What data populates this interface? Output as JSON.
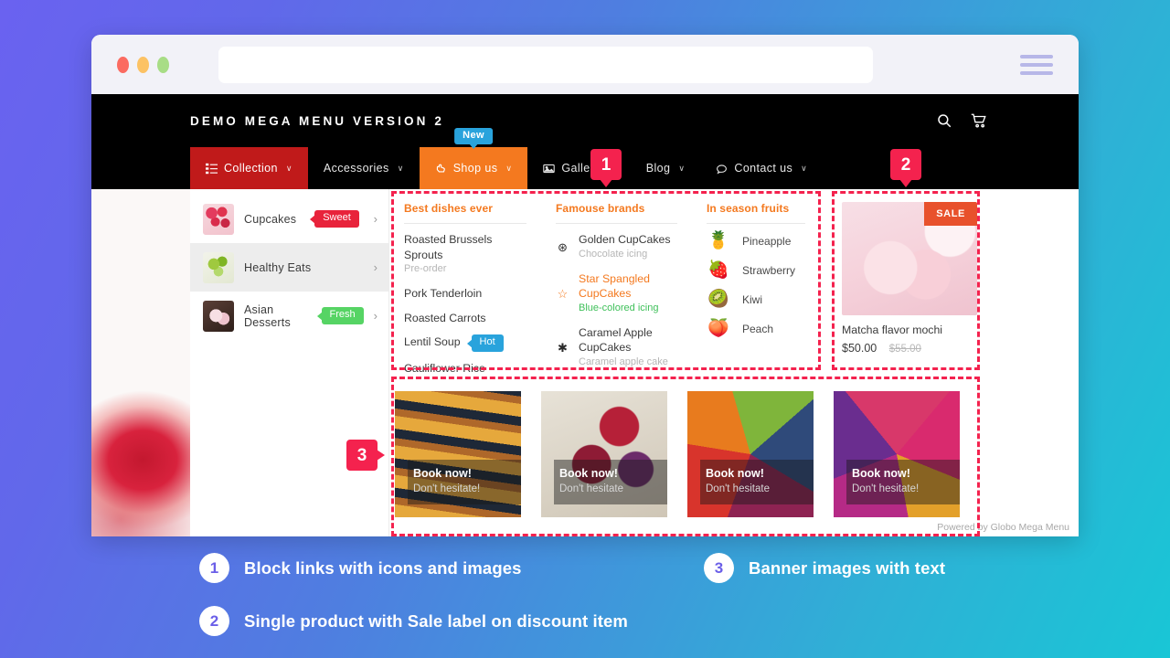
{
  "browser": {
    "dots": [
      "close",
      "minimize",
      "maximize"
    ],
    "url_value": "",
    "url_placeholder": "",
    "menu_icon": "hamburger-icon"
  },
  "site_header": {
    "brand": "DEMO MEGA MENU VERSION 2",
    "icons": [
      "search-icon",
      "cart-icon"
    ]
  },
  "navbar": {
    "items": [
      {
        "label": "Collection",
        "icon": "list-icon",
        "caret": "∨",
        "state": "active-red",
        "badge": ""
      },
      {
        "label": "Accessories",
        "icon": "",
        "caret": "∨",
        "state": "",
        "badge": ""
      },
      {
        "label": "Shop us",
        "icon": "hand-icon",
        "caret": "∨",
        "state": "active-orange",
        "badge": "New"
      },
      {
        "label": "Gallery",
        "icon": "image-icon",
        "caret": "∨",
        "state": "",
        "badge": ""
      },
      {
        "label": "Blog",
        "icon": "",
        "caret": "∨",
        "state": "",
        "badge": ""
      },
      {
        "label": "Contact us",
        "icon": "chat-icon",
        "caret": "∨",
        "state": "",
        "badge": ""
      }
    ],
    "search_icon": "search-icon"
  },
  "sidebar": {
    "items": [
      {
        "label": "Cupcakes",
        "badge": "Sweet",
        "badge_color": "red",
        "thumb": "cupcakes-thumb",
        "arrow": "›",
        "hover": false
      },
      {
        "label": "Healthy Eats",
        "badge": "",
        "badge_color": "",
        "thumb": "healthy-thumb",
        "arrow": "›",
        "hover": true
      },
      {
        "label": "Asian Desserts",
        "badge": "Fresh",
        "badge_color": "green",
        "thumb": "asian-thumb",
        "arrow": "›",
        "hover": false
      }
    ]
  },
  "columns": [
    {
      "heading": "Best dishes ever",
      "links": [
        {
          "icon": "",
          "title": "Roasted Brussels Sprouts",
          "sub": "Pre-order",
          "sub_color": "grey",
          "title_color": "dark",
          "badge": "",
          "badge_color": ""
        },
        {
          "icon": "",
          "title": "Pork Tenderloin",
          "sub": "",
          "sub_color": "",
          "title_color": "dark",
          "badge": "",
          "badge_color": ""
        },
        {
          "icon": "",
          "title": "Roasted Carrots",
          "sub": "",
          "sub_color": "",
          "title_color": "dark",
          "badge": "",
          "badge_color": ""
        },
        {
          "icon": "",
          "title": "Lentil Soup",
          "sub": "",
          "sub_color": "",
          "title_color": "dark",
          "badge": "Hot",
          "badge_color": "blue"
        },
        {
          "icon": "",
          "title": "Cauliflower Rice",
          "sub": "",
          "sub_color": "",
          "title_color": "dark",
          "badge": "",
          "badge_color": ""
        }
      ]
    },
    {
      "heading": "Famouse brands",
      "links": [
        {
          "icon": "⊛",
          "icon_name": "asterisk-circle-icon",
          "title": "Golden CupCakes",
          "sub": "Chocolate icing",
          "sub_color": "grey",
          "title_color": "dark",
          "badge": "",
          "badge_color": ""
        },
        {
          "icon": "☆",
          "icon_name": "star-outline-icon",
          "title": "Star Spangled CupCakes",
          "sub": "Blue-colored icing",
          "sub_color": "green",
          "title_color": "orange",
          "badge": "",
          "badge_color": ""
        },
        {
          "icon": "✱",
          "icon_name": "asterisk-icon",
          "title": "Caramel Apple CupCakes",
          "sub": "Caramel apple cake",
          "sub_color": "grey",
          "title_color": "dark",
          "badge": "",
          "badge_color": ""
        }
      ]
    },
    {
      "heading": "In season fruits",
      "fruits": [
        {
          "emoji": "🍍",
          "icon_name": "pineapple-icon",
          "label": "Pineapple"
        },
        {
          "emoji": "🍓",
          "icon_name": "strawberry-icon",
          "label": "Strawberry"
        },
        {
          "emoji": "🥝",
          "icon_name": "kiwi-icon",
          "label": "Kiwi"
        },
        {
          "emoji": "🍑",
          "icon_name": "peach-icon",
          "label": "Peach"
        }
      ]
    }
  ],
  "product": {
    "sale_label": "SALE",
    "title": "Matcha flavor mochi",
    "price": "$50.00",
    "price_old": "$55.00"
  },
  "banners": [
    {
      "title": "Book now!",
      "subtitle": "Don't hesitate!"
    },
    {
      "title": "Book now!",
      "subtitle": "Don't hesitate"
    },
    {
      "title": "Book now!",
      "subtitle": "Don't hesitate"
    },
    {
      "title": "Book now!",
      "subtitle": "Don't hesitate!"
    }
  ],
  "powered_by": "Powered by Globo Mega Menu",
  "markers": {
    "one": "1",
    "two": "2",
    "three": "3"
  },
  "legend": [
    {
      "num": "1",
      "text": "Block links with icons and images"
    },
    {
      "num": "3",
      "text": "Banner images with text"
    },
    {
      "num": "2",
      "text": "Single product with Sale label on discount item"
    }
  ],
  "colors": {
    "accent_red": "#f4224e",
    "nav_red": "#c01a1a",
    "nav_orange": "#f4791f",
    "badge_blue": "#29a3dc",
    "badge_green": "#56d464",
    "sale_orange": "#e8512c",
    "gradient_start": "#6a62f0",
    "gradient_end": "#19c6d6"
  }
}
